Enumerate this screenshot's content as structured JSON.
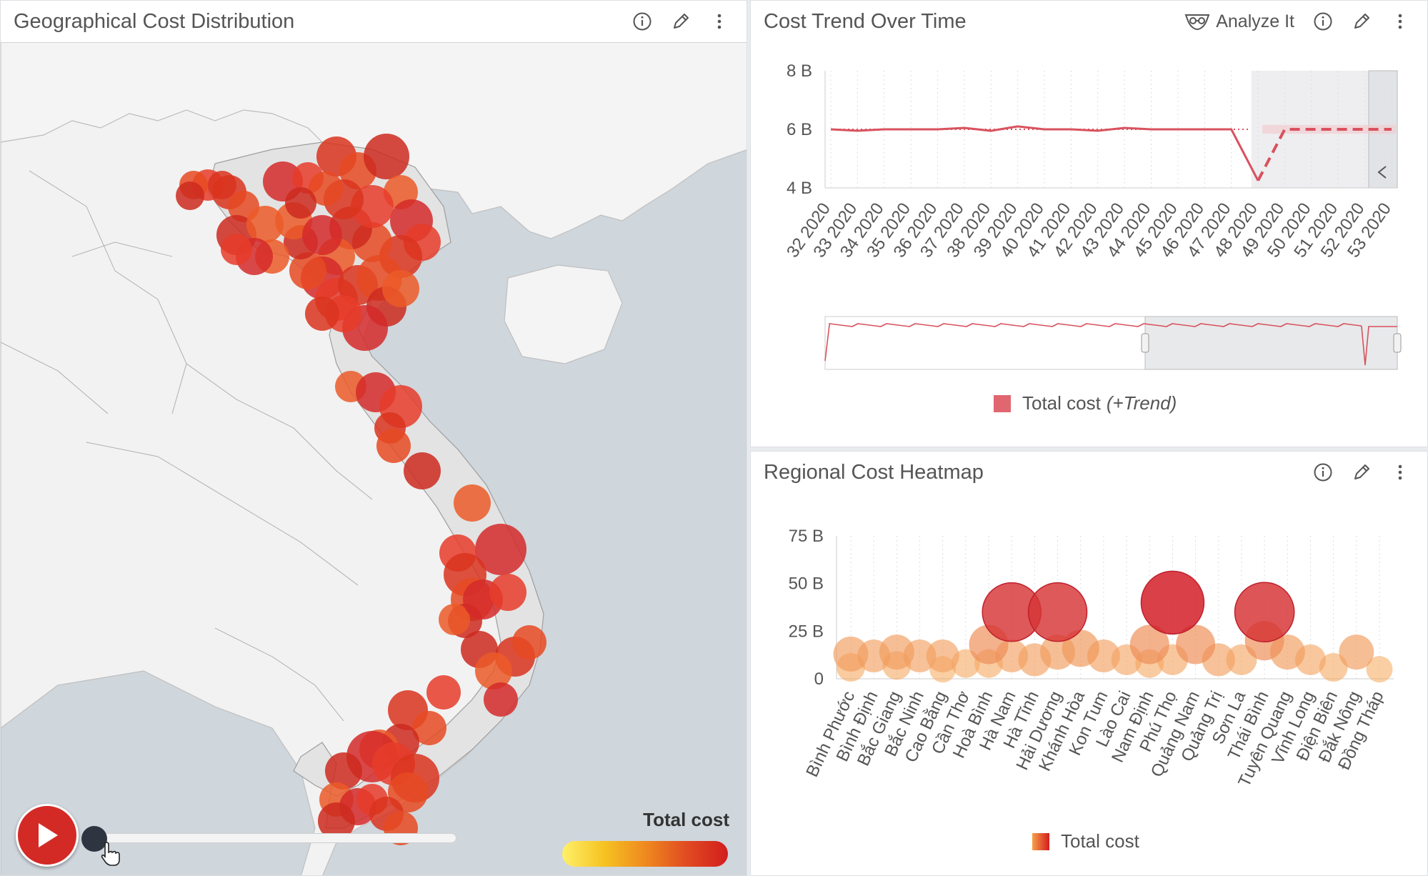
{
  "map": {
    "title": "Geographical Cost Distribution",
    "legend_title": "Total cost",
    "legend_colors": [
      "#fff06a",
      "#f6c322",
      "#ef8a1f",
      "#e14b22",
      "#d21d1d"
    ],
    "icons": [
      "info-icon",
      "pencil-icon",
      "more-vertical-icon",
      "play-icon"
    ],
    "time_slider_position": 0
  },
  "trend": {
    "title": "Cost Trend Over Time",
    "analyze_label": "Analyze It",
    "legend_label": "Total cost",
    "legend_trend": "(+Trend)",
    "icons": [
      "analyze-icon",
      "info-icon",
      "pencil-icon",
      "more-vertical-icon",
      "collapse-left-icon"
    ],
    "series_color": "#d8525e"
  },
  "heatmap": {
    "title": "Regional Cost Heatmap",
    "legend_label": "Total cost",
    "icons": [
      "info-icon",
      "pencil-icon",
      "more-vertical-icon"
    ]
  },
  "chart_data": [
    {
      "type": "line",
      "title": "Cost Trend Over Time",
      "x": [
        "32 2020",
        "33 2020",
        "34 2020",
        "35 2020",
        "36 2020",
        "37 2020",
        "38 2020",
        "39 2020",
        "40 2020",
        "41 2020",
        "42 2020",
        "43 2020",
        "44 2020",
        "45 2020",
        "46 2020",
        "47 2020",
        "48 2020",
        "49 2020",
        "50 2020",
        "51 2020",
        "52 2020",
        "53 2020"
      ],
      "y_ticks": [
        "4 B",
        "6 B",
        "8 B"
      ],
      "ylim": [
        4,
        8
      ],
      "y_unit": "B",
      "series": [
        {
          "name": "Total cost",
          "values": [
            6.0,
            5.95,
            6.0,
            6.0,
            6.0,
            6.05,
            5.95,
            6.1,
            6.0,
            6.0,
            5.95,
            6.05,
            6.0,
            6.0,
            6.0,
            6.0,
            4.25,
            null,
            null,
            null,
            null,
            null
          ]
        },
        {
          "name": "Trend",
          "values": [
            null,
            null,
            null,
            null,
            null,
            null,
            null,
            null,
            null,
            null,
            null,
            null,
            null,
            null,
            null,
            null,
            4.25,
            6.0,
            6.0,
            6.0,
            6.0,
            6.0
          ]
        }
      ],
      "forecast_start": "47 2020",
      "legend_position": "bottom"
    },
    {
      "type": "scatter",
      "title": "Regional Cost Heatmap",
      "categories": [
        "Bình Phước",
        "Bình Định",
        "Bắc Giang",
        "Bắc Ninh",
        "Cao Bằng",
        "Cần Thơ",
        "Hoà Bình",
        "Hà Nam",
        "Hà Tĩnh",
        "Hải Dương",
        "Khánh Hòa",
        "Kon Tum",
        "Lào Cai",
        "Nam Định",
        "Phú Thọ",
        "Quảng Nam",
        "Quảng Trị",
        "Sơn La",
        "Thái Bình",
        "Tuyên Quang",
        "Vĩnh Long",
        "Điện Biên",
        "Đắk Nông",
        "Đồng Tháp"
      ],
      "y_ticks": [
        "0",
        "25 B",
        "50 B",
        "75 B"
      ],
      "ylim": [
        0,
        75
      ],
      "y_unit": "B",
      "points": [
        {
          "x": "Bình Phước",
          "y": 13,
          "v": 0.35
        },
        {
          "x": "Bình Phước",
          "y": 6,
          "v": 0.2
        },
        {
          "x": "Bình Định",
          "y": 12,
          "v": 0.3
        },
        {
          "x": "Bắc Giang",
          "y": 14,
          "v": 0.35
        },
        {
          "x": "Bắc Giang",
          "y": 7,
          "v": 0.2
        },
        {
          "x": "Bắc Ninh",
          "y": 12,
          "v": 0.3
        },
        {
          "x": "Cao Bằng",
          "y": 12,
          "v": 0.3
        },
        {
          "x": "Cao Bằng",
          "y": 5,
          "v": 0.15
        },
        {
          "x": "Cần Thơ",
          "y": 8,
          "v": 0.2
        },
        {
          "x": "Hoà Bình",
          "y": 18,
          "v": 0.45
        },
        {
          "x": "Hoà Bình",
          "y": 8,
          "v": 0.2
        },
        {
          "x": "Hà Nam",
          "y": 35,
          "v": 0.9
        },
        {
          "x": "Hà Nam",
          "y": 12,
          "v": 0.3
        },
        {
          "x": "Hà Tĩnh",
          "y": 10,
          "v": 0.3
        },
        {
          "x": "Hải Dương",
          "y": 35,
          "v": 0.9
        },
        {
          "x": "Hải Dương",
          "y": 14,
          "v": 0.35
        },
        {
          "x": "Khánh Hòa",
          "y": 16,
          "v": 0.4
        },
        {
          "x": "Kon Tum",
          "y": 12,
          "v": 0.3
        },
        {
          "x": "Lào Cai",
          "y": 10,
          "v": 0.25
        },
        {
          "x": "Nam Định",
          "y": 18,
          "v": 0.45
        },
        {
          "x": "Nam Định",
          "y": 8,
          "v": 0.2
        },
        {
          "x": "Phú Thọ",
          "y": 40,
          "v": 1.0
        },
        {
          "x": "Phú Thọ",
          "y": 10,
          "v": 0.25
        },
        {
          "x": "Quảng Nam",
          "y": 18,
          "v": 0.45
        },
        {
          "x": "Quảng Trị",
          "y": 10,
          "v": 0.3
        },
        {
          "x": "Sơn La",
          "y": 10,
          "v": 0.25
        },
        {
          "x": "Thái Bình",
          "y": 35,
          "v": 0.92
        },
        {
          "x": "Thái Bình",
          "y": 20,
          "v": 0.45
        },
        {
          "x": "Tuyên Quang",
          "y": 14,
          "v": 0.35
        },
        {
          "x": "Vĩnh Long",
          "y": 10,
          "v": 0.25
        },
        {
          "x": "Điện Biên",
          "y": 6,
          "v": 0.2
        },
        {
          "x": "Đắk Nông",
          "y": 14,
          "v": 0.35
        },
        {
          "x": "Đồng Tháp",
          "y": 5,
          "v": 0.15
        }
      ],
      "legend_position": "bottom"
    }
  ]
}
